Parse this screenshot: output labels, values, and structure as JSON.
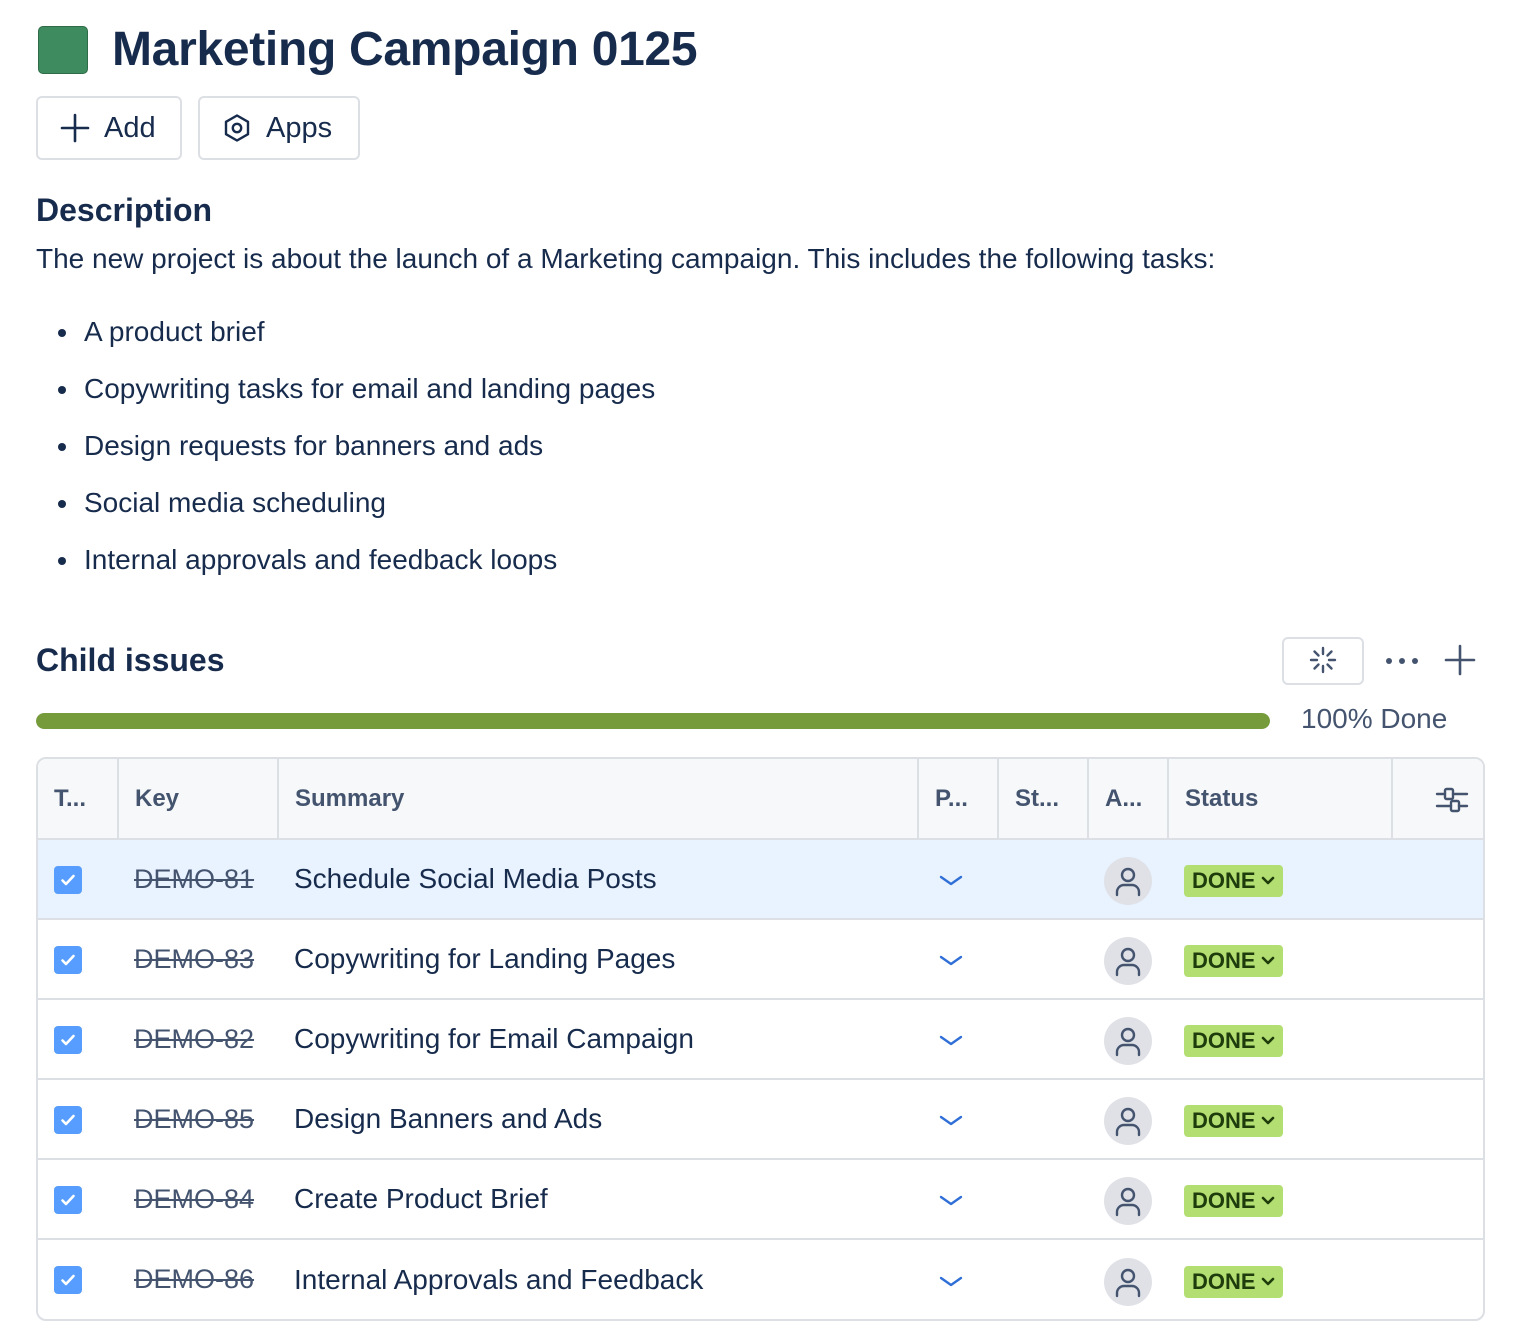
{
  "issue": {
    "title": "Marketing Campaign 0125",
    "epic_color": "#3d8b5e"
  },
  "actions": {
    "add_label": "Add",
    "apps_label": "Apps"
  },
  "description": {
    "heading": "Description",
    "intro": "The new project is about the launch of a Marketing campaign. This includes the following tasks:",
    "items": [
      "A product brief",
      "Copywriting tasks for email and landing pages",
      "Design requests for banners and ads",
      "Social media scheduling",
      "Internal approvals and feedback loops"
    ]
  },
  "child_issues": {
    "heading": "Child issues",
    "progress_percent": 100,
    "progress_label": "100% Done",
    "progress_color": "#769b3a",
    "columns": {
      "type": "T...",
      "key": "Key",
      "summary": "Summary",
      "priority": "P...",
      "story_points": "St...",
      "assignee": "A...",
      "status": "Status"
    },
    "rows": [
      {
        "key": "DEMO-81",
        "summary": "Schedule Social Media Posts",
        "status": "DONE",
        "selected": true
      },
      {
        "key": "DEMO-83",
        "summary": "Copywriting for Landing Pages",
        "status": "DONE",
        "selected": false
      },
      {
        "key": "DEMO-82",
        "summary": "Copywriting for Email Campaign",
        "status": "DONE",
        "selected": false
      },
      {
        "key": "DEMO-85",
        "summary": "Design Banners and Ads",
        "status": "DONE",
        "selected": false
      },
      {
        "key": "DEMO-84",
        "summary": "Create Product Brief",
        "status": "DONE",
        "selected": false
      },
      {
        "key": "DEMO-86",
        "summary": "Internal Approvals and Feedback",
        "status": "DONE",
        "selected": false
      }
    ],
    "status_color": "#b3df72",
    "icons": {
      "type": "checkbox-icon",
      "priority": "chevron-down-icon",
      "assignee": "person-icon",
      "loader": "loader-icon",
      "more": "more-icon",
      "add": "plus-icon",
      "column_config": "sliders-icon"
    }
  }
}
